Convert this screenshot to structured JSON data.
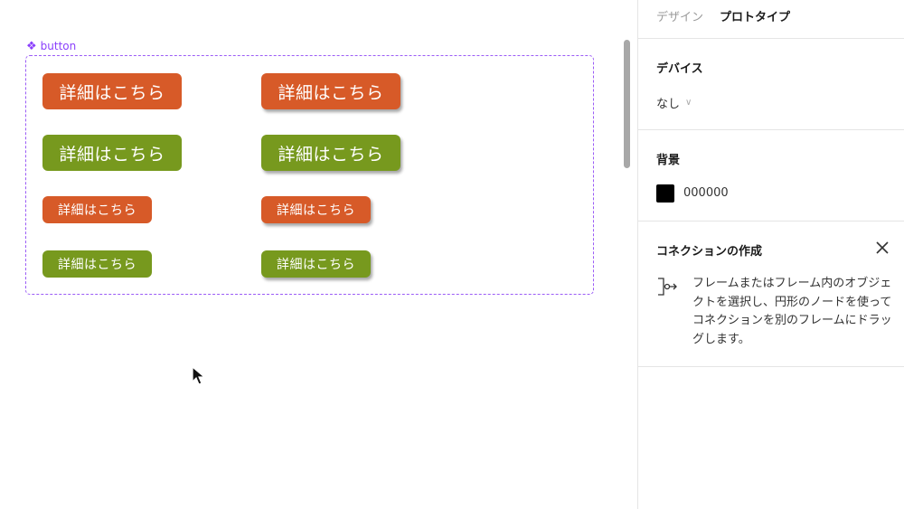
{
  "canvas": {
    "component_label": "button",
    "buttons": [
      {
        "text": "詳細はこちら"
      },
      {
        "text": "詳細はこちら"
      },
      {
        "text": "詳細はこちら"
      },
      {
        "text": "詳細はこちら"
      },
      {
        "text": "詳細はこちら"
      },
      {
        "text": "詳細はこちら"
      },
      {
        "text": "詳細はこちら"
      },
      {
        "text": "詳細はこちら"
      }
    ],
    "colors": {
      "orange": "#d75a28",
      "green": "#77991e",
      "frame": "#9b5cf6"
    }
  },
  "panel": {
    "tabs": [
      {
        "label": "デザイン",
        "active": false
      },
      {
        "label": "プロトタイプ",
        "active": true
      }
    ],
    "device": {
      "title": "デバイス",
      "value": "なし"
    },
    "background": {
      "title": "背景",
      "color": "#000000",
      "hex": "000000"
    },
    "connection": {
      "title": "コネクションの作成",
      "help": "フレームまたはフレーム内のオブジェクトを選択し、円形のノードを使ってコネクションを別のフレームにドラッグします。"
    }
  }
}
